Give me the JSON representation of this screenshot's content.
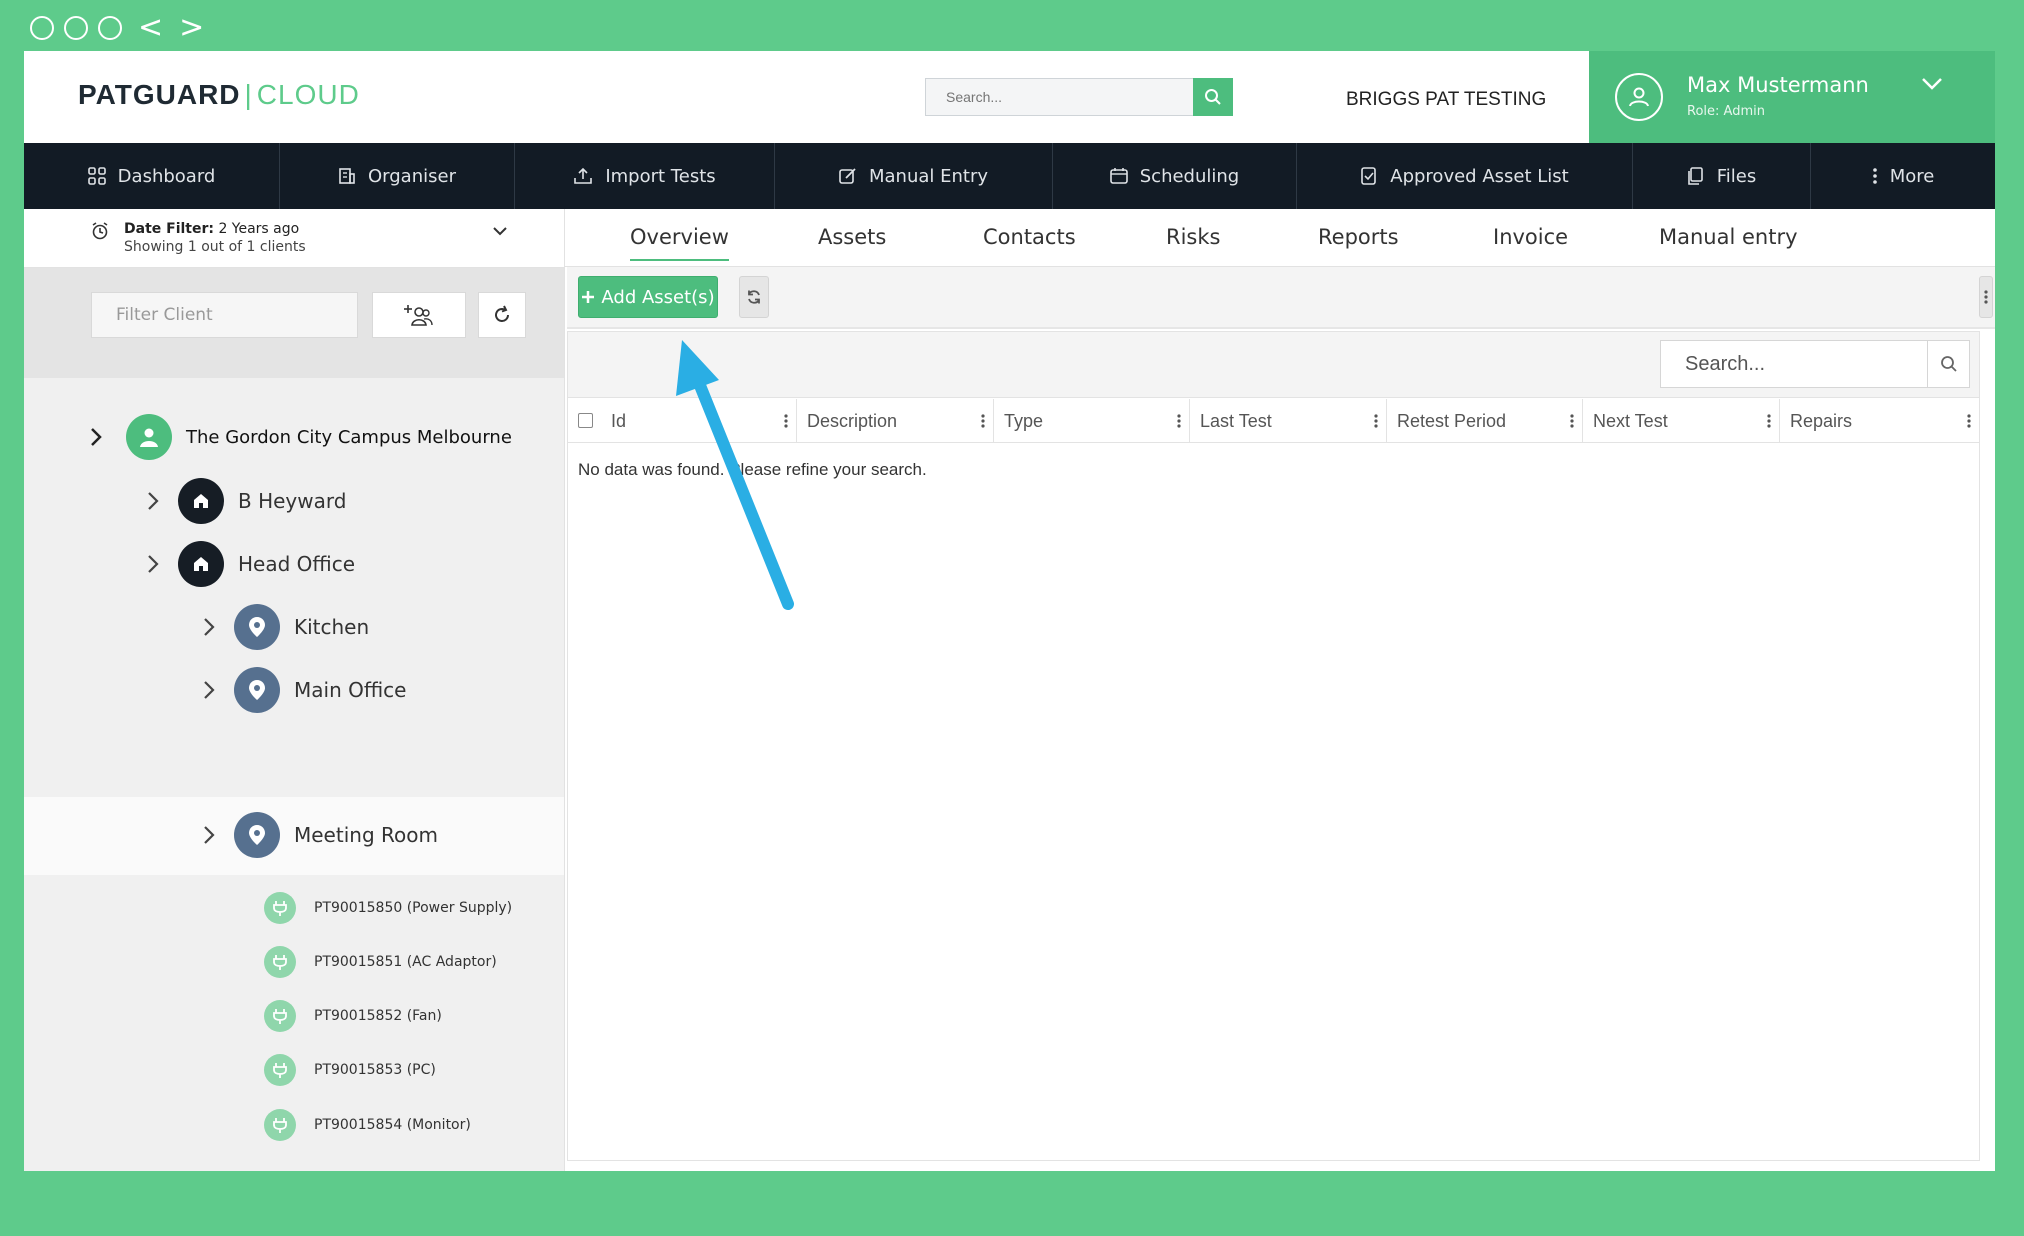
{
  "header": {
    "logo_primary": "PATGUARD",
    "logo_separator": "|",
    "logo_secondary": "CLOUD",
    "search_placeholder": "Search...",
    "company_name": "BRIGGS PAT TESTING",
    "user_name": "Max Mustermann",
    "user_role": "Role: Admin"
  },
  "nav": {
    "items": [
      {
        "label": "Dashboard",
        "icon": "grid-icon"
      },
      {
        "label": "Organiser",
        "icon": "building-icon"
      },
      {
        "label": "Import Tests",
        "icon": "upload-icon"
      },
      {
        "label": "Manual Entry",
        "icon": "edit-icon"
      },
      {
        "label": "Scheduling",
        "icon": "calendar-icon"
      },
      {
        "label": "Approved Asset List",
        "icon": "checklist-icon"
      },
      {
        "label": "Files",
        "icon": "files-icon"
      },
      {
        "label": "More",
        "icon": "kebab-icon"
      }
    ]
  },
  "date_filter": {
    "label": "Date Filter:",
    "value": "2 Years ago",
    "showing": "Showing 1 out of 1 clients"
  },
  "client_filter": {
    "placeholder": "Filter Client"
  },
  "tree": {
    "client": "The Gordon City Campus Melbourne",
    "sites": [
      "B Heyward",
      "Head Office"
    ],
    "locations": [
      "Kitchen",
      "Main Office",
      "Meeting Room"
    ],
    "assets": [
      "PT90015850 (Power Supply)",
      "PT90015851 (AC Adaptor)",
      "PT90015852 (Fan)",
      "PT90015853 (PC)",
      "PT90015854 (Monitor)"
    ]
  },
  "tabs": [
    "Overview",
    "Assets",
    "Contacts",
    "Risks",
    "Reports",
    "Invoice",
    "Manual entry"
  ],
  "active_tab": "Overview",
  "toolbar": {
    "add_label": "Add Asset(s)"
  },
  "grid": {
    "search_placeholder": "Search...",
    "columns": [
      "Id",
      "Description",
      "Type",
      "Last Test",
      "Retest Period",
      "Next Test",
      "Repairs"
    ],
    "empty_message": "No data was found. Please refine your search."
  },
  "colors": {
    "brand_green": "#4dbd7e",
    "frame_green": "#5ecb8b",
    "nav_dark": "#121b25",
    "arrow_blue": "#2aaee4"
  }
}
